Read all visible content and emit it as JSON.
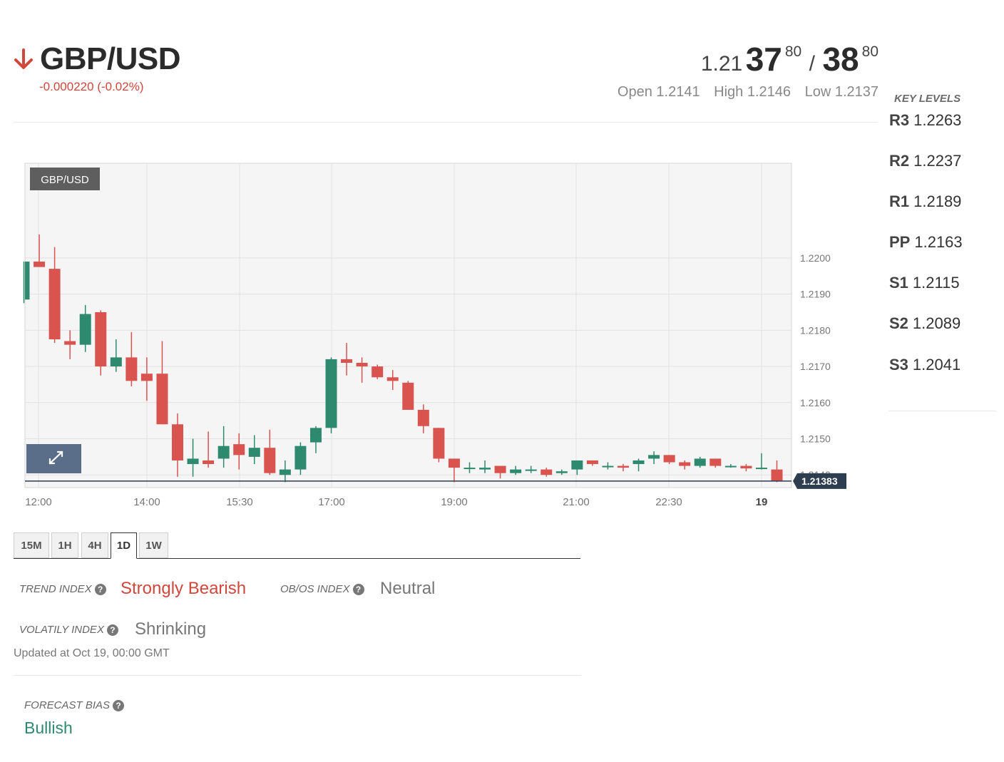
{
  "header": {
    "pair": "GBP/USD",
    "change": "-0.000220 (-0.02%)",
    "trend_arrow": "down-arrow-icon",
    "bid": {
      "prefix": "1.21",
      "big": "37",
      "pip": "80"
    },
    "separator": "/",
    "ask": {
      "big": "38",
      "pip": "80"
    },
    "open": "Open 1.2141",
    "high": "High 1.2146",
    "low": "Low 1.2137"
  },
  "key_levels": {
    "title": "KEY LEVELS",
    "items": [
      {
        "name": "R3",
        "value": "1.2263"
      },
      {
        "name": "R2",
        "value": "1.2237"
      },
      {
        "name": "R1",
        "value": "1.2189"
      },
      {
        "name": "PP",
        "value": "1.2163"
      },
      {
        "name": "S1",
        "value": "1.2115"
      },
      {
        "name": "S2",
        "value": "1.2089"
      },
      {
        "name": "S3",
        "value": "1.2041"
      }
    ]
  },
  "chart_data": {
    "type": "candlestick",
    "legend": "GBP/USD",
    "current_price_label": "1.21383",
    "current_price": 1.21383,
    "x_tick_labels": [
      "12:00",
      "14:00",
      "15:30",
      "17:00",
      "19:00",
      "21:00",
      "22:30",
      "19"
    ],
    "y_tick_labels": [
      "1.2200",
      "1.2190",
      "1.2180",
      "1.2170",
      "1.2160",
      "1.2150",
      "1.2140"
    ],
    "ylim": [
      1.21365,
      1.22262
    ],
    "grid": true,
    "colors": {
      "up": "#2e8a6e",
      "down": "#d9534f",
      "price_line": "#2c3e50"
    },
    "candles": [
      {
        "o": 1.21885,
        "h": 1.2199,
        "l": 1.21875,
        "c": 1.2199
      },
      {
        "o": 1.2199,
        "h": 1.22065,
        "l": 1.2198,
        "c": 1.21975
      },
      {
        "o": 1.2197,
        "h": 1.2203,
        "l": 1.21765,
        "c": 1.21775
      },
      {
        "o": 1.2177,
        "h": 1.218,
        "l": 1.2172,
        "c": 1.2176
      },
      {
        "o": 1.2176,
        "h": 1.2187,
        "l": 1.2174,
        "c": 1.21845
      },
      {
        "o": 1.2185,
        "h": 1.21855,
        "l": 1.21675,
        "c": 1.217
      },
      {
        "o": 1.217,
        "h": 1.21775,
        "l": 1.21685,
        "c": 1.21725
      },
      {
        "o": 1.21725,
        "h": 1.21795,
        "l": 1.21645,
        "c": 1.2166
      },
      {
        "o": 1.2168,
        "h": 1.21725,
        "l": 1.21605,
        "c": 1.2166
      },
      {
        "o": 1.2168,
        "h": 1.2177,
        "l": 1.2154,
        "c": 1.2154
      },
      {
        "o": 1.2154,
        "h": 1.2157,
        "l": 1.21395,
        "c": 1.2144
      },
      {
        "o": 1.2143,
        "h": 1.215,
        "l": 1.21395,
        "c": 1.21445
      },
      {
        "o": 1.2144,
        "h": 1.2152,
        "l": 1.2142,
        "c": 1.2143
      },
      {
        "o": 1.21445,
        "h": 1.21535,
        "l": 1.2142,
        "c": 1.2148
      },
      {
        "o": 1.21485,
        "h": 1.21515,
        "l": 1.21415,
        "c": 1.21455
      },
      {
        "o": 1.2145,
        "h": 1.2151,
        "l": 1.2143,
        "c": 1.21475
      },
      {
        "o": 1.21475,
        "h": 1.21525,
        "l": 1.214,
        "c": 1.21405
      },
      {
        "o": 1.214,
        "h": 1.2144,
        "l": 1.2138,
        "c": 1.21415
      },
      {
        "o": 1.21415,
        "h": 1.2149,
        "l": 1.214,
        "c": 1.2148
      },
      {
        "o": 1.2149,
        "h": 1.21535,
        "l": 1.2146,
        "c": 1.2153
      },
      {
        "o": 1.2153,
        "h": 1.21725,
        "l": 1.21515,
        "c": 1.2172
      },
      {
        "o": 1.2172,
        "h": 1.21765,
        "l": 1.21675,
        "c": 1.2171
      },
      {
        "o": 1.2171,
        "h": 1.21725,
        "l": 1.21655,
        "c": 1.217
      },
      {
        "o": 1.217,
        "h": 1.21705,
        "l": 1.21665,
        "c": 1.2167
      },
      {
        "o": 1.2167,
        "h": 1.2169,
        "l": 1.21635,
        "c": 1.2166
      },
      {
        "o": 1.21655,
        "h": 1.2166,
        "l": 1.2158,
        "c": 1.2158
      },
      {
        "o": 1.2158,
        "h": 1.21595,
        "l": 1.21515,
        "c": 1.21535
      },
      {
        "o": 1.2153,
        "h": 1.2153,
        "l": 1.21435,
        "c": 1.21445
      },
      {
        "o": 1.21445,
        "h": 1.21445,
        "l": 1.2138,
        "c": 1.2142
      },
      {
        "o": 1.2142,
        "h": 1.21435,
        "l": 1.21405,
        "c": 1.2142
      },
      {
        "o": 1.21415,
        "h": 1.2144,
        "l": 1.21405,
        "c": 1.2142
      },
      {
        "o": 1.21425,
        "h": 1.21425,
        "l": 1.2139,
        "c": 1.21405
      },
      {
        "o": 1.21405,
        "h": 1.21425,
        "l": 1.214,
        "c": 1.21415
      },
      {
        "o": 1.21415,
        "h": 1.21425,
        "l": 1.21405,
        "c": 1.21415
      },
      {
        "o": 1.21415,
        "h": 1.2142,
        "l": 1.21395,
        "c": 1.214
      },
      {
        "o": 1.21405,
        "h": 1.21415,
        "l": 1.214,
        "c": 1.2141
      },
      {
        "o": 1.21415,
        "h": 1.2144,
        "l": 1.214,
        "c": 1.2144
      },
      {
        "o": 1.2144,
        "h": 1.2144,
        "l": 1.21425,
        "c": 1.2143
      },
      {
        "o": 1.21425,
        "h": 1.21435,
        "l": 1.21415,
        "c": 1.21425
      },
      {
        "o": 1.21425,
        "h": 1.2143,
        "l": 1.2141,
        "c": 1.2142
      },
      {
        "o": 1.2143,
        "h": 1.21445,
        "l": 1.2141,
        "c": 1.2144
      },
      {
        "o": 1.21445,
        "h": 1.21465,
        "l": 1.2143,
        "c": 1.21455
      },
      {
        "o": 1.21455,
        "h": 1.21455,
        "l": 1.2143,
        "c": 1.21435
      },
      {
        "o": 1.21435,
        "h": 1.2144,
        "l": 1.21415,
        "c": 1.21425
      },
      {
        "o": 1.21425,
        "h": 1.2145,
        "l": 1.2142,
        "c": 1.21445
      },
      {
        "o": 1.21445,
        "h": 1.21445,
        "l": 1.2142,
        "c": 1.21425
      },
      {
        "o": 1.21425,
        "h": 1.2143,
        "l": 1.2142,
        "c": 1.21425
      },
      {
        "o": 1.21425,
        "h": 1.2143,
        "l": 1.2141,
        "c": 1.21418
      },
      {
        "o": 1.21418,
        "h": 1.2146,
        "l": 1.21415,
        "c": 1.2142
      },
      {
        "o": 1.21415,
        "h": 1.2144,
        "l": 1.2138,
        "c": 1.21383
      }
    ]
  },
  "timeframes": {
    "items": [
      "15M",
      "1H",
      "4H",
      "1D",
      "1W"
    ],
    "active": "1D"
  },
  "indices": {
    "trend": {
      "label": "TREND INDEX",
      "value": "Strongly Bearish",
      "color": "#d0473b"
    },
    "obos": {
      "label": "OB/OS INDEX",
      "value": "Neutral",
      "color": "#777777"
    },
    "volatility": {
      "label": "VOLATILY INDEX",
      "value": "Shrinking",
      "color": "#777777"
    },
    "help_icon": "question-icon",
    "updated": "Updated at Oct 19, 00:00 GMT"
  },
  "forecast": {
    "label": "FORECAST BIAS",
    "value": "Bullish",
    "color": "#2e8a6e"
  },
  "expand_icon": "expand-icon"
}
